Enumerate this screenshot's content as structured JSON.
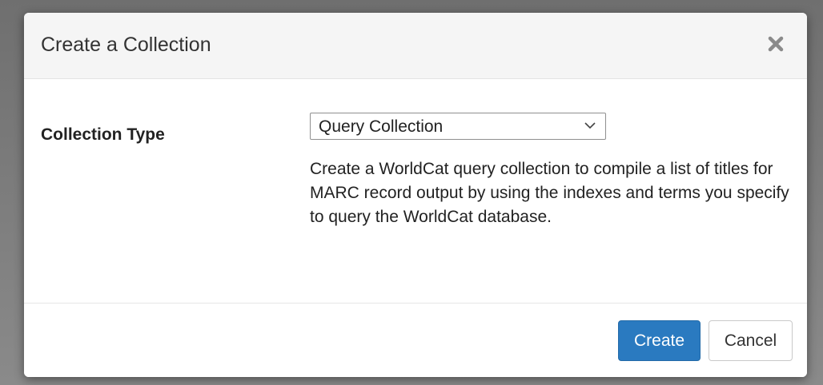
{
  "dialog": {
    "title": "Create a Collection",
    "close_icon": "close-x-icon"
  },
  "form": {
    "collection_type_label": "Collection Type",
    "collection_type_selected": "Query Collection",
    "chevron_icon": "chevron-down-icon",
    "description": "Create a WorldCat query collection to compile a list of titles for MARC record output by using the indexes and terms you specify to query the WorldCat database."
  },
  "footer": {
    "create_label": "Create",
    "cancel_label": "Cancel"
  },
  "colors": {
    "primary": "#2a7ac0",
    "header_bg": "#f5f5f5",
    "backdrop": "#7a7a7a"
  }
}
